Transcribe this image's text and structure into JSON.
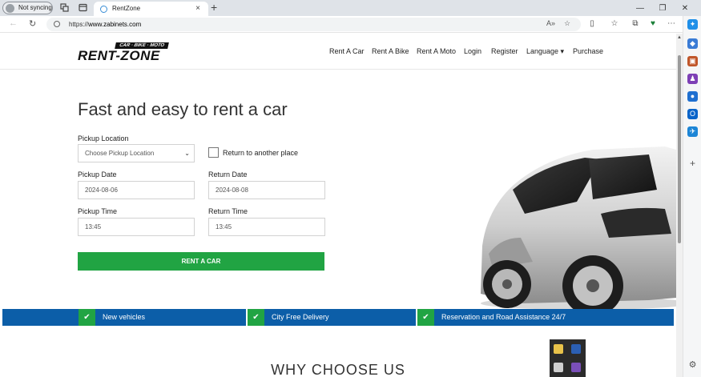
{
  "browser": {
    "profile_label": "Not syncing",
    "tab_title": "RentZone",
    "newtab_symbol": "+",
    "tab_close_symbol": "×",
    "url_prefix": "https://",
    "url_host": "www.zabinets.com",
    "window_controls": [
      "—",
      "❐",
      "✕"
    ]
  },
  "site": {
    "logo_tag": "CAR · BIKE · MOTO",
    "logo_word": "RENT-ZONE",
    "nav": [
      "Rent A Car",
      "Rent A Bike",
      "Rent A Moto",
      "Login",
      "Register",
      "Language ▾",
      "Purchase"
    ]
  },
  "hero": {
    "title": "Fast and easy to rent a car",
    "pickup_location_label": "Pickup Location",
    "pickup_location_value": "Choose Pickup Location",
    "return_other_label": "Return to another place",
    "pickup_date_label": "Pickup Date",
    "pickup_date_value": "2024-08-06",
    "return_date_label": "Return Date",
    "return_date_value": "2024-08-08",
    "pickup_time_label": "Pickup Time",
    "pickup_time_value": "13:45",
    "return_time_label": "Return Time",
    "return_time_value": "13:45",
    "submit_label": "RENT A CAR"
  },
  "features": [
    {
      "label": "New vehicles"
    },
    {
      "label": "City Free Delivery"
    },
    {
      "label": "Reservation and Road Assistance 24/7"
    }
  ],
  "section_heading": "WHY CHOOSE US",
  "colors": {
    "accent_green": "#21a443",
    "features_blue": "#0c5ea8"
  }
}
